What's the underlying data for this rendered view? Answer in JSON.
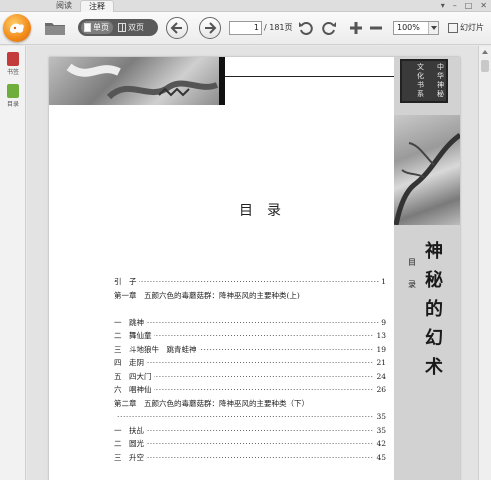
{
  "tabs": [
    {
      "label": "阅读"
    },
    {
      "label": "注释"
    }
  ],
  "window_controls": [
    "▾",
    "–",
    "□",
    "✕"
  ],
  "toolbar": {
    "single_page_label": "单页",
    "double_page_label": "双页",
    "current_page": "1",
    "total_pages": "/ 181页",
    "zoom": "100%",
    "slideshow_label": "幻灯片"
  },
  "sidebar": {
    "items": [
      {
        "label": "书签",
        "icon": "bookmark-icon"
      },
      {
        "label": "目录",
        "icon": "toc-icon"
      }
    ]
  },
  "document": {
    "seal_chars": [
      "中",
      "华",
      "神",
      "秘",
      "文",
      "化",
      "书",
      "系"
    ],
    "side_small": "目录",
    "side_title": [
      "神",
      "秘",
      "的",
      "幻",
      "术"
    ],
    "toc_title": "目录",
    "toc": [
      {
        "label": "引　子",
        "page": "1",
        "dots": true
      },
      {
        "label": "第一章　五颜六色的毒蘑菇群：降神巫风的主要种类(上)",
        "page": "",
        "dots": false
      },
      {
        "label": "",
        "page": "",
        "dots": false
      },
      {
        "label": "一　跳神",
        "page": "9",
        "dots": true
      },
      {
        "label": "二　舞仙童",
        "page": "13",
        "dots": true
      },
      {
        "label": "三　斗地狼牛　跳青蛙神",
        "page": "19",
        "dots": true
      },
      {
        "label": "四　走阴",
        "page": "21",
        "dots": true
      },
      {
        "label": "五　四大门",
        "page": "24",
        "dots": true
      },
      {
        "label": "六　唱神仙",
        "page": "26",
        "dots": true
      },
      {
        "label": "第二章　五颜六色的毒蘑菇群：降神巫风的主要种类（下）",
        "page": "",
        "dots": false
      },
      {
        "label": "",
        "page": "35",
        "dots": true
      },
      {
        "label": "一　扶乩",
        "page": "35",
        "dots": true
      },
      {
        "label": "二　圆光",
        "page": "42",
        "dots": true
      },
      {
        "label": "三　升空",
        "page": "45",
        "dots": true
      }
    ]
  }
}
